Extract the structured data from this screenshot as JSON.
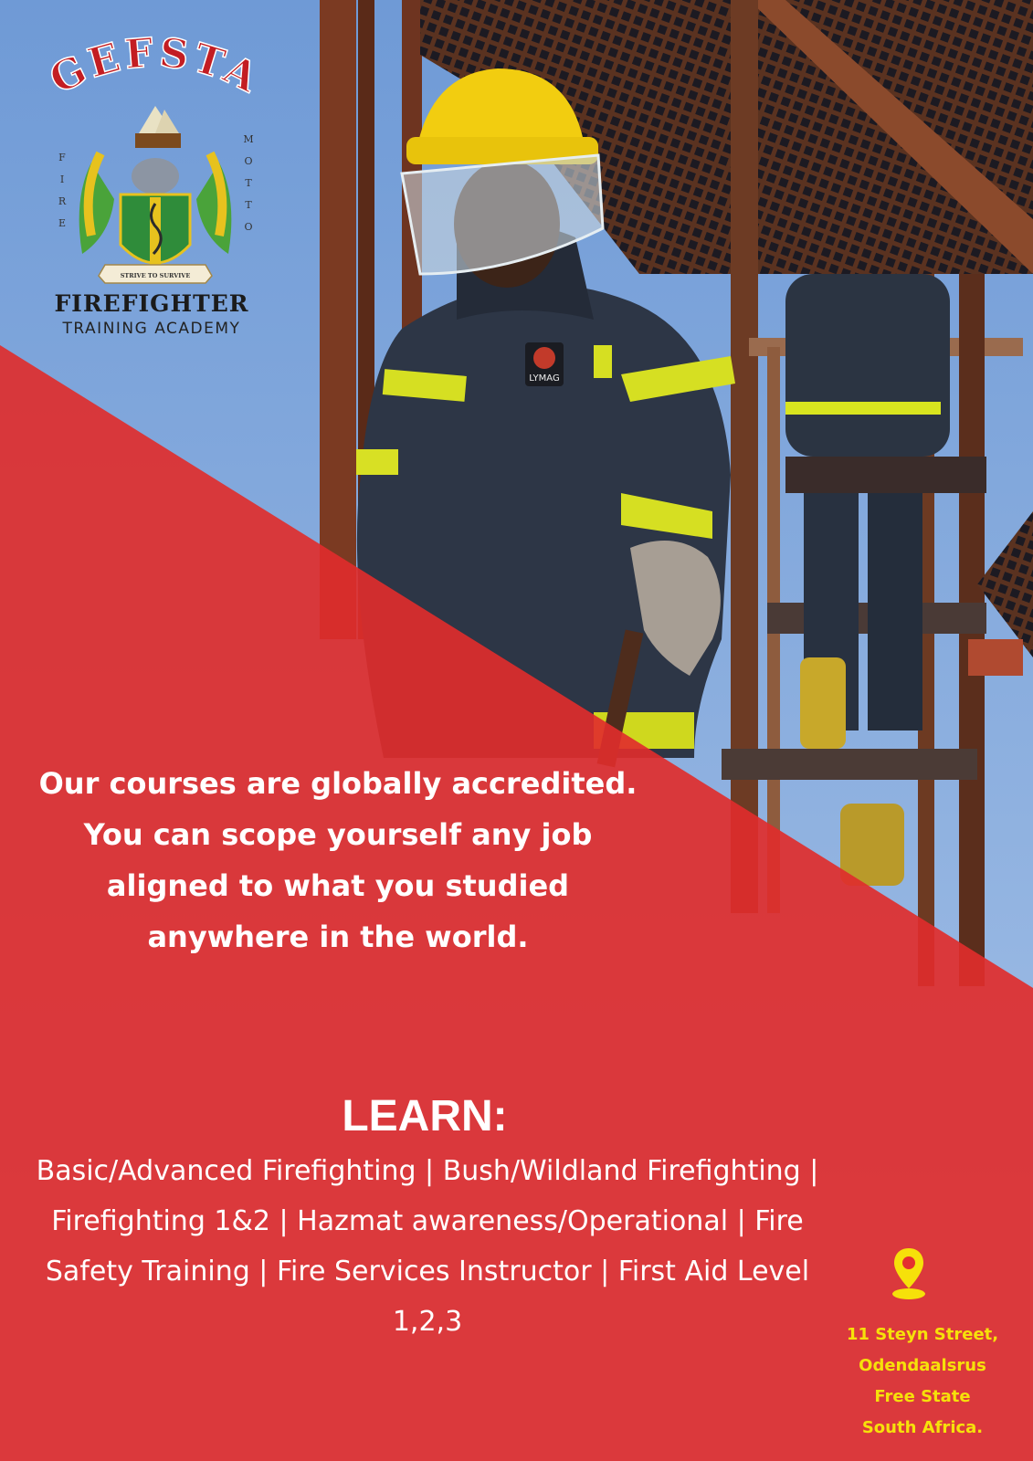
{
  "logo": {
    "brand": "GEFSTA",
    "left_letters": [
      "F",
      "I",
      "R",
      "E"
    ],
    "right_letters": [
      "M",
      "O",
      "T",
      "T",
      "O"
    ],
    "motto": "STRIVE TO SURVIVE",
    "name": "FIREFIGHTER",
    "subtitle": "TRAINING ACADEMY"
  },
  "patch_text": "LYMAG",
  "intro_text": "Our courses are globally accredited. You can scope yourself any job aligned to what you studied anywhere in the world.",
  "learn": {
    "heading": "LEARN:",
    "courses_line": "Basic/Advanced Firefighting | Bush/Wildland Firefighting | Firefighting 1&2 | Hazmat awareness/Operational | Fire Safety Training | Fire Services Instructor | First Aid Level 1,2,3"
  },
  "address": {
    "icon": "map-pin-icon",
    "lines": [
      "11 Steyn Street,",
      "Odendaalsrus",
      "Free State",
      "South Africa."
    ]
  },
  "colors": {
    "sky": "#7fa6d9",
    "red": "#e4302f",
    "helmet": "#f2cd10",
    "reflective": "#d9e21e",
    "address_text": "#f6e10a"
  }
}
